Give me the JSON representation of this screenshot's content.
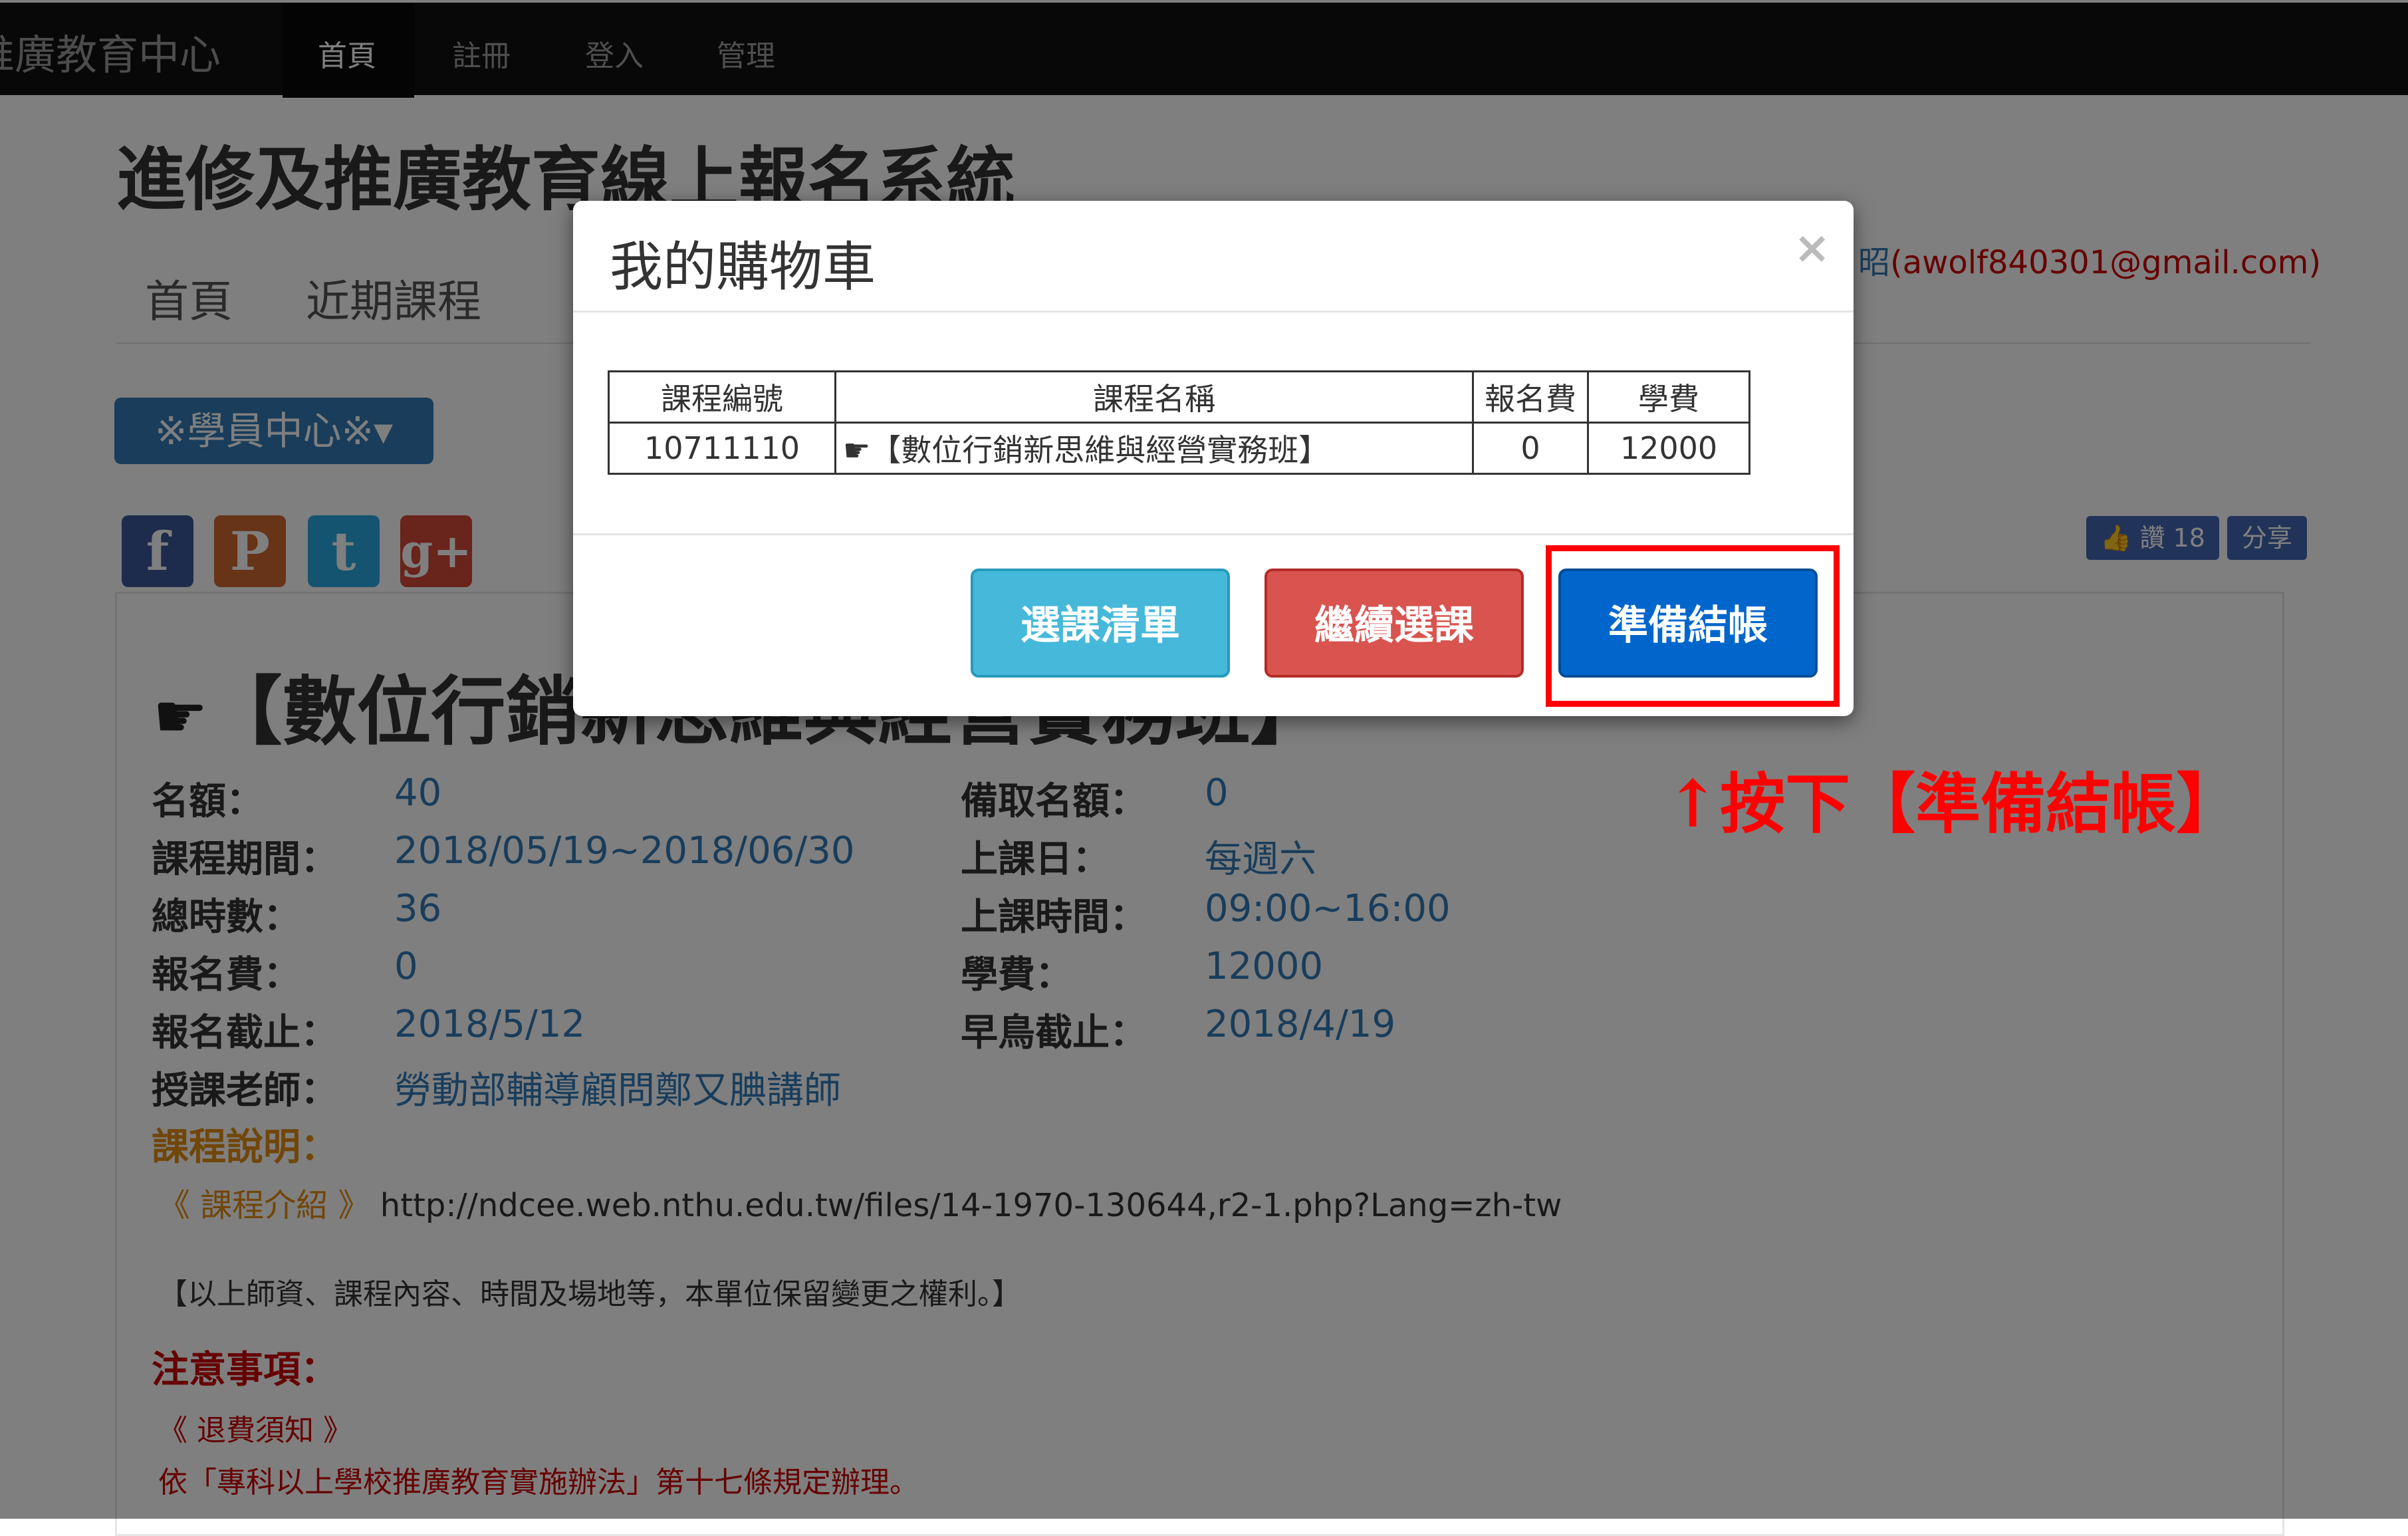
{
  "navbar": {
    "brand": "推廣教育中心",
    "items": [
      "首頁",
      "註冊",
      "登入",
      "管理"
    ]
  },
  "site": {
    "title": "進修及推廣教育線上報名系統",
    "menu": [
      "首頁",
      "近期課程"
    ],
    "user_name": "昭",
    "user_email": "(awolf840301@gmail.com)",
    "student_center": "※學員中心※▾"
  },
  "social": {
    "icons": [
      "facebook-icon",
      "plurk-icon",
      "twitter-icon",
      "google-plus-icon"
    ],
    "like_label": "讚 18",
    "share_label": "分享"
  },
  "course": {
    "title": "【數位行銷新思維與經營實務班】",
    "fields_left": [
      {
        "label": "名額：",
        "value": "40"
      },
      {
        "label": "課程期間：",
        "value": "2018/05/19~2018/06/30"
      },
      {
        "label": "總時數：",
        "value": "36"
      },
      {
        "label": "報名費：",
        "value": "0"
      },
      {
        "label": "報名截止：",
        "value": "2018/5/12"
      },
      {
        "label": "授課老師：",
        "value": "勞動部輔導顧問鄭又腆講師"
      }
    ],
    "fields_right": [
      {
        "label": "備取名額：",
        "value": "0"
      },
      {
        "label": "上課日：",
        "value": "每週六"
      },
      {
        "label": "上課時間：",
        "value": "09:00~16:00"
      },
      {
        "label": "學費：",
        "value": "12000"
      },
      {
        "label": "早鳥截止：",
        "value": "2018/4/19"
      }
    ],
    "desc_label": "課程說明：",
    "intro_bracket": "《 課程介紹 》",
    "intro_url": "http://ndcee.web.nthu.edu.tw/files/14-1970-130644,r2-1.php?Lang=zh-tw",
    "note": "【以上師資、課程內容、時間及場地等，本單位保留變更之權利。】",
    "notice_title": "注意事項：",
    "refund_title": "《 退費須知 》",
    "refund_rule": "依「專科以上學校推廣教育實施辦法」第十七條規定辦理。"
  },
  "modal": {
    "title": "我的購物車",
    "close": "×",
    "table": {
      "headers": [
        "課程編號",
        "課程名稱",
        "報名費",
        "學費"
      ],
      "rows": [
        [
          "10711110",
          "【數位行銷新思維與經營實務班】",
          "0",
          "12000"
        ]
      ]
    },
    "buttons": {
      "list": "選課清單",
      "continue": "繼續選課",
      "checkout": "準備結帳"
    }
  },
  "annotation": "↑按下【準備結帳】",
  "colors": {
    "navbar": "#111111",
    "primary": "#337ab7",
    "info": "#5bc0de",
    "danger": "#d9534f",
    "checkout": "#0066cc",
    "annotation": "#ff0000"
  }
}
